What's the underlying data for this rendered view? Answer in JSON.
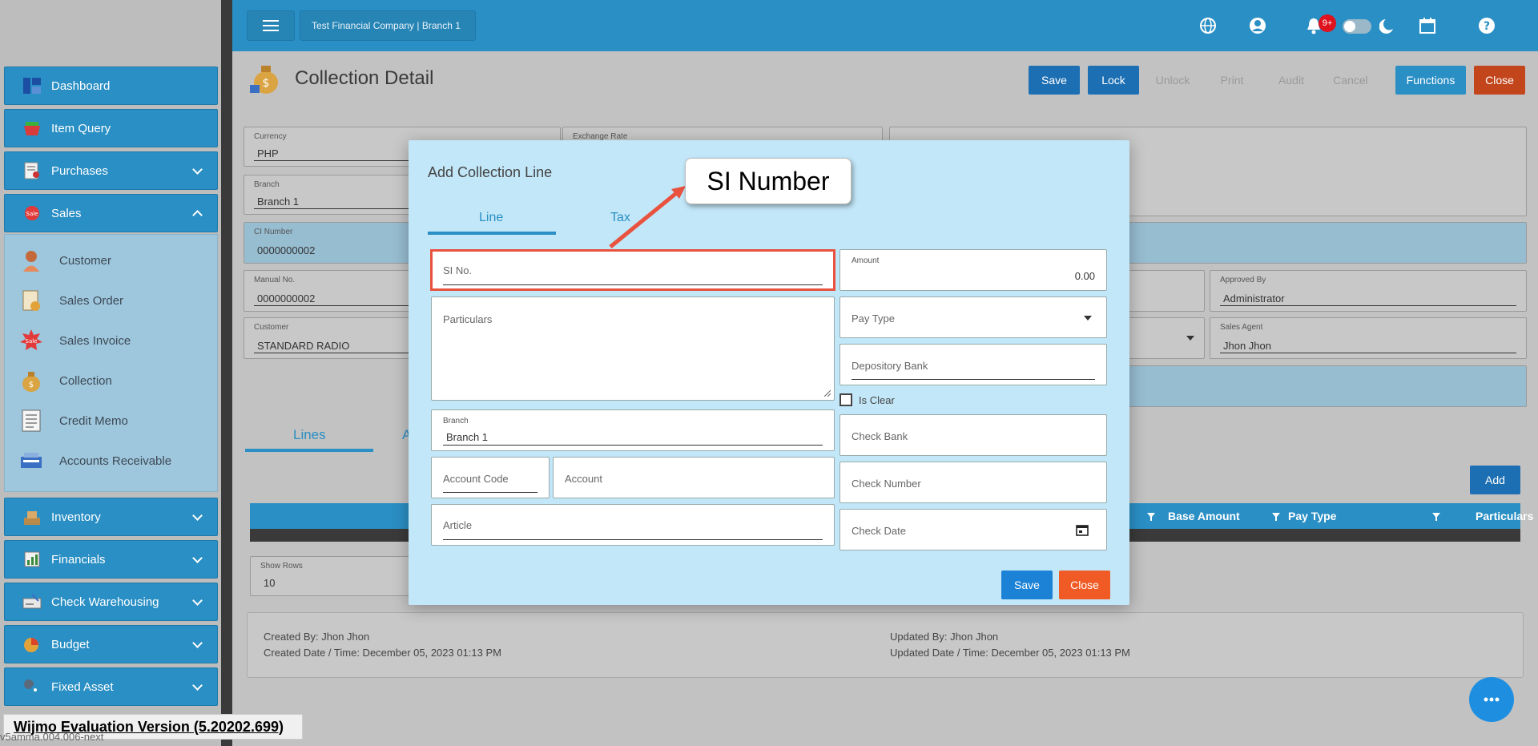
{
  "header": {
    "company": "Test Financial Company | Branch 1",
    "notification_count": "9+"
  },
  "sidebar": {
    "items": [
      {
        "label": "Dashboard",
        "icon": "dashboard-icon"
      },
      {
        "label": "Item Query",
        "icon": "basket-icon"
      },
      {
        "label": "Purchases",
        "icon": "purchases-icon"
      },
      {
        "label": "Sales",
        "icon": "sale-tag-icon"
      },
      {
        "label": "Inventory",
        "icon": "inventory-icon"
      },
      {
        "label": "Financials",
        "icon": "financials-icon"
      },
      {
        "label": "Check Warehousing",
        "icon": "check-icon"
      },
      {
        "label": "Budget",
        "icon": "budget-icon"
      },
      {
        "label": "Fixed Asset",
        "icon": "fixed-asset-icon"
      }
    ],
    "sales_sub": [
      {
        "label": "Customer",
        "icon": "customer-icon"
      },
      {
        "label": "Sales Order",
        "icon": "sales-order-icon"
      },
      {
        "label": "Sales Invoice",
        "icon": "sales-invoice-icon"
      },
      {
        "label": "Collection",
        "icon": "collection-icon"
      },
      {
        "label": "Credit Memo",
        "icon": "credit-memo-icon"
      },
      {
        "label": "Accounts Receivable",
        "icon": "accounts-receivable-icon"
      }
    ]
  },
  "page": {
    "title": "Collection Detail",
    "buttons": {
      "save": "Save",
      "lock": "Lock",
      "unlock": "Unlock",
      "print": "Print",
      "audit": "Audit",
      "cancel": "Cancel",
      "functions": "Functions",
      "close": "Close"
    }
  },
  "form": {
    "currency_label": "Currency",
    "currency_value": "PHP",
    "exchange_label": "Exchange Rate",
    "branch_label": "Branch",
    "branch_value": "Branch 1",
    "ci_label": "CI Number",
    "ci_value": "0000000002",
    "manual_label": "Manual No.",
    "manual_value": "0000000002",
    "customer_label": "Customer",
    "customer_value": "STANDARD RADIO",
    "approved_label": "Approved By",
    "approved_value": "Administrator",
    "agent_label": "Sales Agent",
    "agent_value": "Jhon Jhon"
  },
  "lines_tab": "Lines",
  "lines_tab2": "A",
  "add_button": "Add",
  "grid": {
    "columns": [
      "Base Amount",
      "Pay Type",
      "Particulars"
    ]
  },
  "show_rows": {
    "label": "Show Rows",
    "value": "10"
  },
  "footer": {
    "created_by": "Created By: Jhon Jhon",
    "created_date": "Created Date / Time: December 05, 2023 01:13 PM",
    "updated_by": "Updated By: Jhon Jhon",
    "updated_date": "Updated Date / Time: December 05, 2023 01:13 PM"
  },
  "modal": {
    "title": "Add Collection Line",
    "tabs": [
      "Line",
      "Tax"
    ],
    "si_placeholder": "SI No.",
    "amount_label": "Amount",
    "amount_value": "0.00",
    "particulars_placeholder": "Particulars",
    "pay_type_placeholder": "Pay Type",
    "depository_bank_placeholder": "Depository Bank",
    "is_clear_label": "Is Clear",
    "branch_label": "Branch",
    "branch_value": "Branch 1",
    "check_bank_placeholder": "Check Bank",
    "account_code_placeholder": "Account Code",
    "account_placeholder": "Account",
    "check_number_placeholder": "Check Number",
    "article_placeholder": "Article",
    "check_date_placeholder": "Check Date",
    "save": "Save",
    "close": "Close"
  },
  "callout": "SI Number",
  "wijmo": "Wijmo Evaluation Version (5.20202.699)",
  "version": "v5amma.004.006-next",
  "colors": {
    "primary": "#2a8fc4",
    "modal_bg": "#c2e7f8",
    "highlight": "#e8523f",
    "close_red": "#f05a24"
  }
}
